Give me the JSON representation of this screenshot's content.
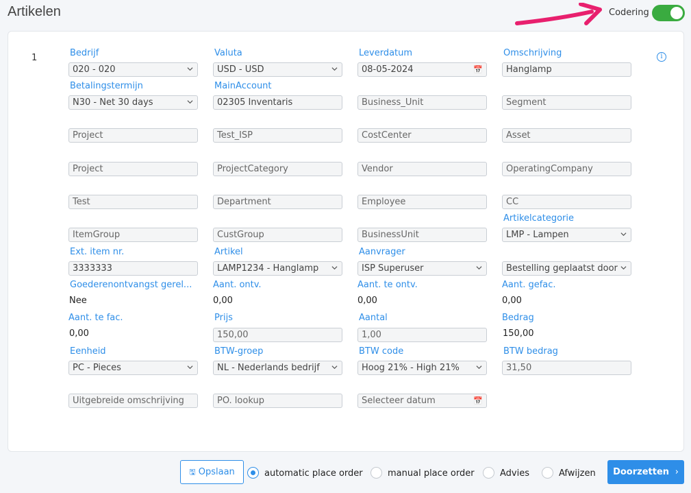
{
  "header": {
    "title": "Artikelen",
    "coding_label": "Codering",
    "coding_on": true,
    "accent": "#2e8ee8",
    "toggle_color": "#3aab40",
    "arrow_color": "#e8206e"
  },
  "row": {
    "number": "1"
  },
  "fields": {
    "bedrijf": {
      "label": "Bedrijf",
      "value": "020 - 020"
    },
    "valuta": {
      "label": "Valuta",
      "value": "USD - USD"
    },
    "leverdatum": {
      "label": "Leverdatum",
      "value": "08-05-2024"
    },
    "omschrijving": {
      "label": "Omschrijving",
      "value": "Hanglamp"
    },
    "betalingstermijn": {
      "label": "Betalingstermijn",
      "value": "N30 - Net 30 days"
    },
    "mainaccount": {
      "label": "MainAccount",
      "value": "02305 Inventaris"
    },
    "business_unit": {
      "placeholder": "Business_Unit"
    },
    "segment": {
      "placeholder": "Segment"
    },
    "project1": {
      "placeholder": "Project"
    },
    "test_isp": {
      "placeholder": "Test_ISP"
    },
    "costcenter": {
      "placeholder": "CostCenter"
    },
    "asset": {
      "placeholder": "Asset"
    },
    "project2": {
      "placeholder": "Project"
    },
    "projectcategory": {
      "placeholder": "ProjectCategory"
    },
    "vendor": {
      "placeholder": "Vendor"
    },
    "operatingcompany": {
      "placeholder": "OperatingCompany"
    },
    "test": {
      "placeholder": "Test"
    },
    "department": {
      "placeholder": "Department"
    },
    "employee": {
      "placeholder": "Employee"
    },
    "cc": {
      "placeholder": "CC"
    },
    "itemgroup": {
      "placeholder": "ItemGroup"
    },
    "custgroup": {
      "placeholder": "CustGroup"
    },
    "businessunit": {
      "placeholder": "BusinessUnit"
    },
    "artikelcategorie": {
      "label": "Artikelcategorie",
      "value": "LMP - Lampen"
    },
    "ext_item": {
      "label": "Ext. item nr.",
      "value": "3333333"
    },
    "artikel": {
      "label": "Artikel",
      "value": "LAMP1234 - Hanglamp"
    },
    "aanvrager": {
      "label": "Aanvrager",
      "value": "ISP Superuser"
    },
    "bestelling": {
      "value": "Bestelling geplaatst door"
    },
    "goederenontvangst": {
      "label": "Goederenontvangst gerel...",
      "value": "Nee"
    },
    "aant_ontv": {
      "label": "Aant. ontv.",
      "value": "0,00"
    },
    "aant_te_ontv": {
      "label": "Aant. te ontv.",
      "value": "0,00"
    },
    "aant_gefac": {
      "label": "Aant. gefac.",
      "value": "0,00"
    },
    "aant_te_fac": {
      "label": "Aant. te fac.",
      "value": "0,00"
    },
    "prijs": {
      "label": "Prijs",
      "value": "150,00"
    },
    "aantal": {
      "label": "Aantal",
      "value": "1,00"
    },
    "bedrag": {
      "label": "Bedrag",
      "value": "150,00"
    },
    "eenheid": {
      "label": "Eenheid",
      "value": "PC - Pieces"
    },
    "btw_groep": {
      "label": "BTW-groep",
      "value": "NL - Nederlands bedrijf"
    },
    "btw_code": {
      "label": "BTW code",
      "value": "Hoog 21% - High 21%"
    },
    "btw_bedrag": {
      "label": "BTW bedrag",
      "value": "31,50"
    },
    "uitgebreide": {
      "placeholder": "Uitgebreide omschrijving"
    },
    "po_lookup": {
      "placeholder": "PO. lookup"
    },
    "datum": {
      "placeholder": "Selecteer datum"
    }
  },
  "footer": {
    "save_label": "Opslaan",
    "options": [
      {
        "label": "automatic place order",
        "checked": true
      },
      {
        "label": "manual place order",
        "checked": false
      },
      {
        "label": "Advies",
        "checked": false
      },
      {
        "label": "Afwijzen",
        "checked": false
      }
    ],
    "next_label": "Doorzetten"
  }
}
